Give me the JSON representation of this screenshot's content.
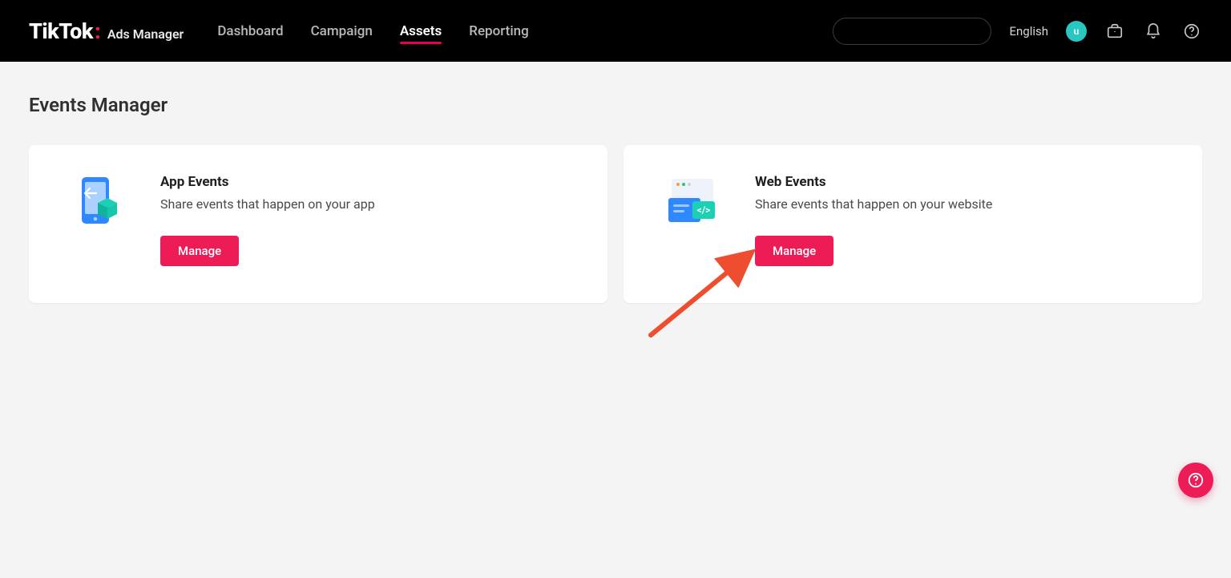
{
  "brand": {
    "name": "TikTok",
    "sub": "Ads Manager"
  },
  "nav": {
    "items": [
      {
        "label": "Dashboard",
        "active": false
      },
      {
        "label": "Campaign",
        "active": false
      },
      {
        "label": "Assets",
        "active": true
      },
      {
        "label": "Reporting",
        "active": false
      }
    ]
  },
  "topbar": {
    "language": "English",
    "avatar_initial": "u"
  },
  "page": {
    "title": "Events Manager",
    "cards": [
      {
        "title": "App Events",
        "desc": "Share events that happen on your app",
        "button": "Manage"
      },
      {
        "title": "Web Events",
        "desc": "Share events that happen on your website",
        "button": "Manage"
      }
    ]
  }
}
